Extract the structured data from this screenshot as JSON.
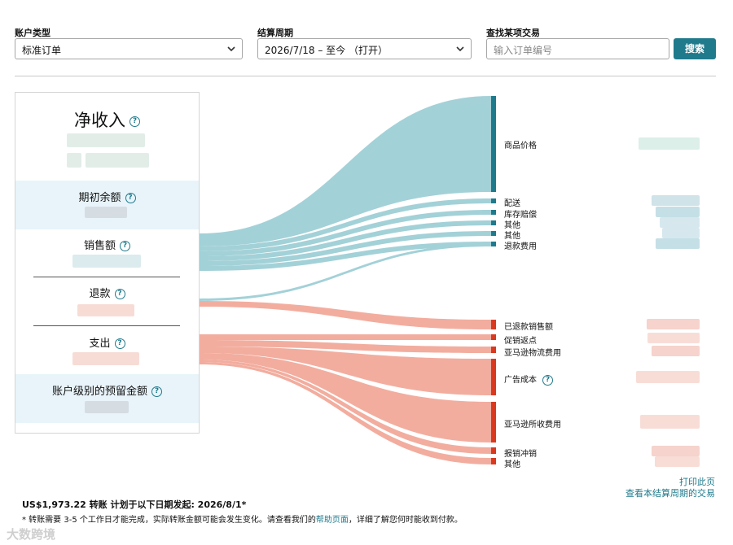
{
  "filters": {
    "account_type_label": "账户类型",
    "account_type_value": "标准订单",
    "period_label": "结算周期",
    "period_value": "2026/7/18 – 至今  （打开）",
    "find_label": "查找某项交易",
    "find_placeholder": "输入订单编号",
    "search_button": "搜索"
  },
  "summary": {
    "net_income": "净收入",
    "opening_balance": "期初余额",
    "sales": "销售额",
    "refunds": "退款",
    "expenses": "支出",
    "reserve": "账户级别的预留金额",
    "help_icon": "?"
  },
  "categories": {
    "income": [
      {
        "label": "商品价格",
        "icon": "help-icon"
      },
      {
        "label": "配送"
      },
      {
        "label": "库存赔偿"
      },
      {
        "label": "其他"
      },
      {
        "label": "其他"
      },
      {
        "label": "退款费用"
      }
    ],
    "expense": [
      {
        "label": "已退款销售额"
      },
      {
        "label": "促销返点"
      },
      {
        "label": "亚马逊物流费用"
      },
      {
        "label": "广告成本",
        "has_help": true
      },
      {
        "label": "亚马逊所收费用"
      },
      {
        "label": "报销冲销"
      },
      {
        "label": "其他"
      }
    ]
  },
  "colors": {
    "teal": "#1f7a8c",
    "teal_flow": "#9fcfd6",
    "salmon_flow": "#f2a99a",
    "red_node": "#d9391f",
    "light_blue_bg": "#e8f4fa"
  },
  "links": {
    "print": "打印此页",
    "view_transactions": "查看本结算周期的交易"
  },
  "footer": {
    "transfer": "US$1,973.22 转账  计划于以下日期发起:   2026/8/1*",
    "note_prefix": "* 转账需要 3-5 个工作日才能完成，实际转账金额可能会发生变化。请查看我们的",
    "note_link": "帮助页面",
    "note_suffix": "，详细了解您何时能收到付款。"
  },
  "watermark": "大数跨境"
}
